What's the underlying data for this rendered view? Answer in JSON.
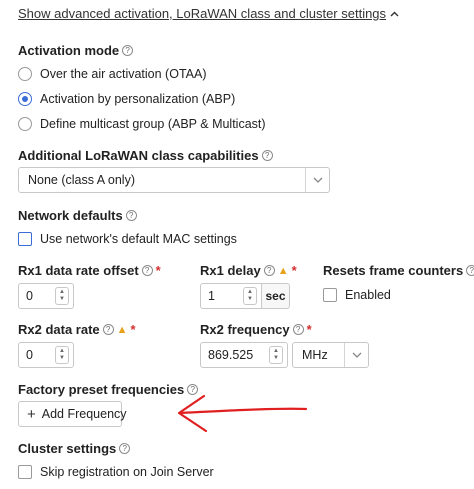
{
  "advanced_toggle": {
    "label": "Show advanced activation, LoRaWAN class and cluster settings",
    "icon": "chevron-up-icon"
  },
  "activation_mode": {
    "label": "Activation mode",
    "options": [
      {
        "label": "Over the air activation (OTAA)",
        "checked": false
      },
      {
        "label": "Activation by personalization (ABP)",
        "checked": true
      },
      {
        "label": "Define multicast group (ABP & Multicast)",
        "checked": false
      }
    ]
  },
  "class_capabilities": {
    "label": "Additional LoRaWAN class capabilities",
    "selected": "None (class A only)"
  },
  "network_defaults": {
    "label": "Network defaults",
    "checkbox_label": "Use network's default MAC settings",
    "checked": false
  },
  "rx1_offset": {
    "label": "Rx1 data rate offset",
    "value": "0"
  },
  "rx1_delay": {
    "label": "Rx1 delay",
    "value": "1",
    "unit": "sec"
  },
  "resets_frame_counters": {
    "label": "Resets frame counters",
    "checkbox_label": "Enabled",
    "checked": false
  },
  "rx2_data_rate": {
    "label": "Rx2 data rate",
    "value": "0"
  },
  "rx2_frequency": {
    "label": "Rx2 frequency",
    "value": "869.525",
    "unit": "MHz"
  },
  "factory_presets": {
    "label": "Factory preset frequencies",
    "button_label": "Add Frequency"
  },
  "cluster_settings": {
    "label": "Cluster settings",
    "checkbox_label": "Skip registration on Join Server",
    "checked": false
  },
  "colors": {
    "accent": "#3a6dd8",
    "required": "#d0302f",
    "warning": "#e8a21a",
    "annotation_arrow": "#e02020"
  }
}
